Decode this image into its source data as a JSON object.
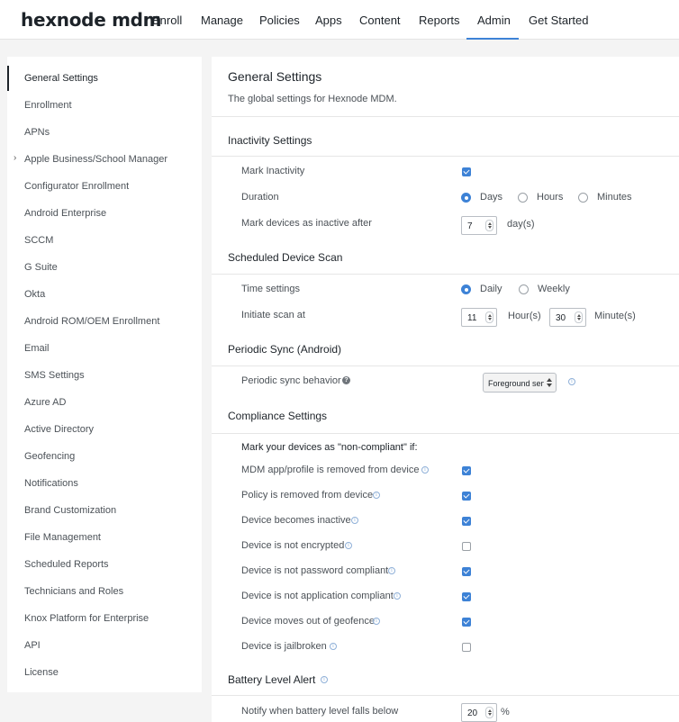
{
  "brand": {
    "logo_text": "hexnode mdm",
    "accent": "#3d82d6"
  },
  "topnav": {
    "items": [
      "Enroll",
      "Manage",
      "Policies",
      "Apps",
      "Content",
      "Reports",
      "Admin",
      "Get Started"
    ],
    "active": "Admin"
  },
  "sidebar": {
    "active": "General Settings",
    "items": [
      "General Settings",
      "Enrollment",
      "APNs",
      "Apple Business/School Manager",
      "Configurator Enrollment",
      "Android Enterprise",
      "SCCM",
      "G Suite",
      "Okta",
      "Android ROM/OEM Enrollment",
      "Email",
      "SMS Settings",
      "Azure AD",
      "Active Directory",
      "Geofencing",
      "Notifications",
      "Brand Customization",
      "File Management",
      "Scheduled Reports",
      "Technicians and Roles",
      "Knox Platform for Enterprise",
      "API",
      "License"
    ]
  },
  "page": {
    "title": "General Settings",
    "description": "The global settings for Hexnode MDM."
  },
  "inactivity": {
    "title": "Inactivity Settings",
    "mark_label": "Mark Inactivity",
    "mark_checked": true,
    "duration_label": "Duration",
    "duration_options": [
      "Days",
      "Hours",
      "Minutes"
    ],
    "duration_selected": "Days",
    "after_label": "Mark devices as inactive after",
    "after_value": "7",
    "after_unit": "day(s)"
  },
  "scan": {
    "title": "Scheduled Device Scan",
    "time_label": "Time settings",
    "time_options": [
      "Daily",
      "Weekly"
    ],
    "time_selected": "Daily",
    "initiate_label": "Initiate scan at",
    "hour_value": "11",
    "hour_unit": "Hour(s)",
    "minute_value": "30",
    "minute_unit": "Minute(s)"
  },
  "sync": {
    "title": "Periodic Sync (Android)",
    "behavior_label": "Periodic sync behavior",
    "behavior_value": "Foreground service"
  },
  "compliance": {
    "title": "Compliance Settings",
    "intro": "Mark your devices as \"non-compliant\" if:",
    "items": [
      {
        "label": "MDM app/profile is removed from device",
        "checked": true
      },
      {
        "label": "Policy is removed from device",
        "checked": true
      },
      {
        "label": "Device becomes inactive",
        "checked": true
      },
      {
        "label": "Device is not encrypted",
        "checked": false
      },
      {
        "label": "Device is not password compliant",
        "checked": true
      },
      {
        "label": "Device is not application compliant",
        "checked": true
      },
      {
        "label": "Device moves out of geofence",
        "checked": true
      },
      {
        "label": "Device is jailbroken",
        "checked": false
      }
    ]
  },
  "battery": {
    "title": "Battery Level Alert",
    "notify_label": "Notify when battery level falls below",
    "value": "20",
    "unit": "%"
  }
}
